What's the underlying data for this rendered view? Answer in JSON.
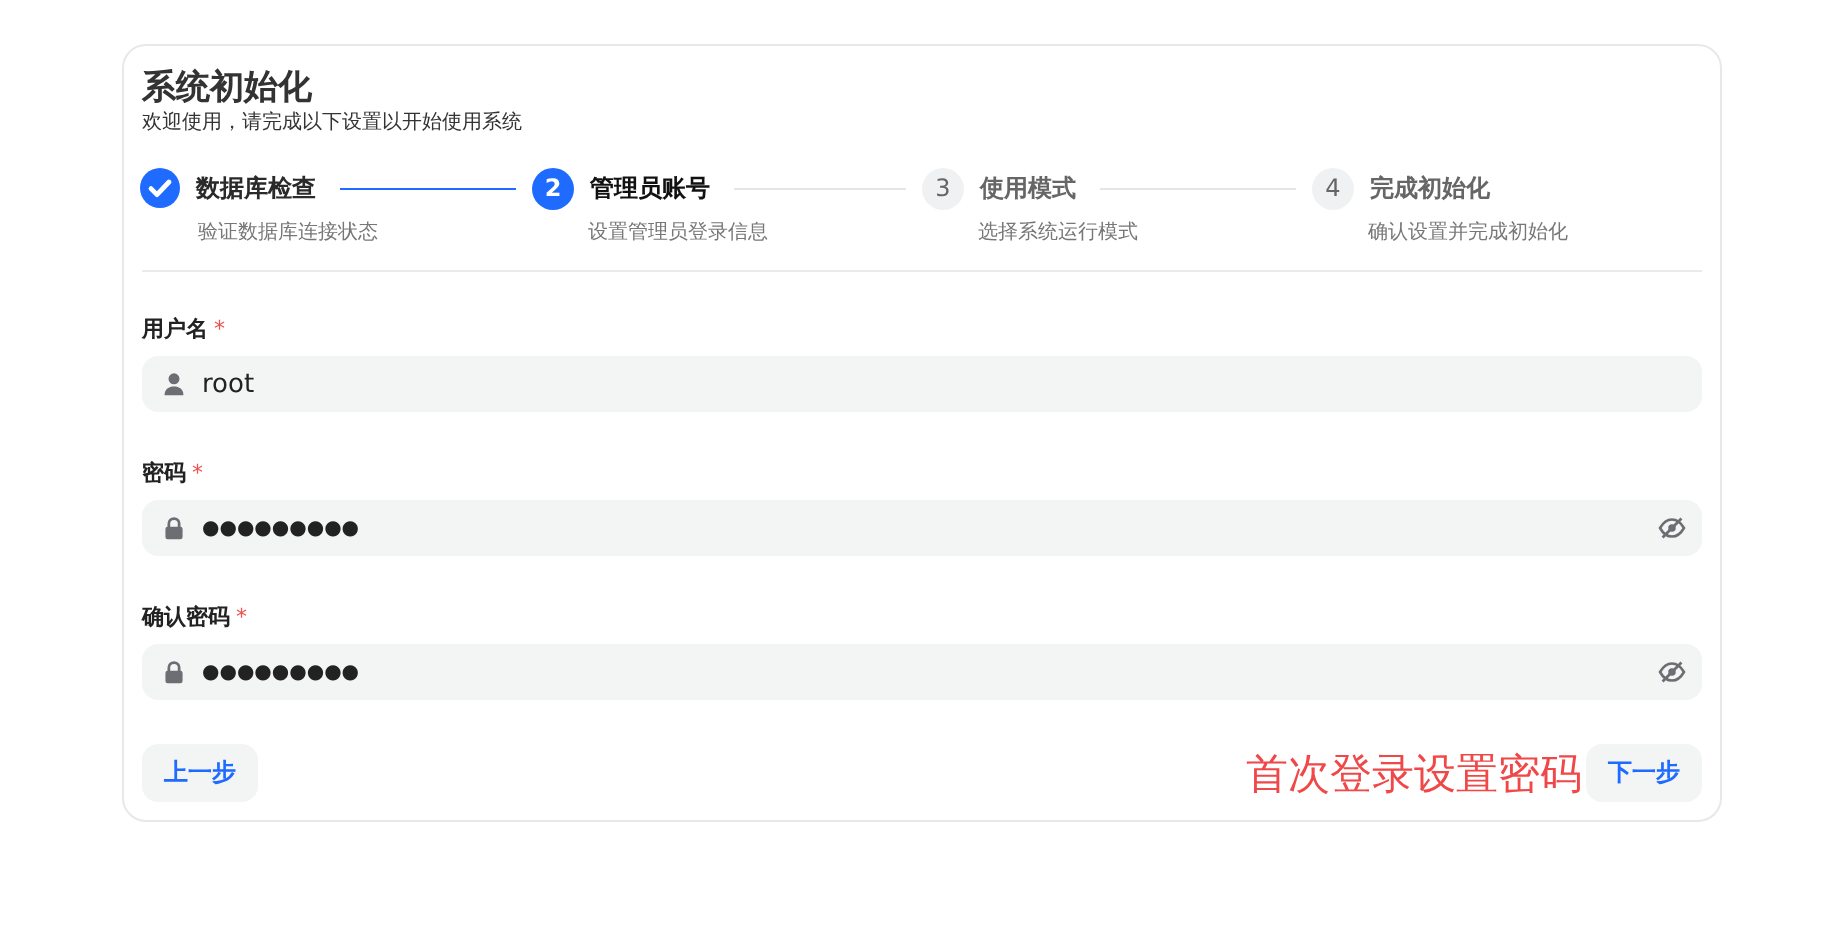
{
  "header": {
    "title": "系统初始化",
    "subtitle": "欢迎使用，请完成以下设置以开始使用系统"
  },
  "steps": [
    {
      "title": "数据库检查",
      "description": "验证数据库连接状态",
      "completed": true,
      "selected": false
    },
    {
      "number": "2",
      "title": "管理员账号",
      "description": "设置管理员登录信息",
      "completed": false,
      "selected": true
    },
    {
      "number": "3",
      "title": "使用模式",
      "description": "选择系统运行模式",
      "completed": false,
      "selected": false
    },
    {
      "number": "4",
      "title": "完成初始化",
      "description": "确认设置并完成初始化",
      "completed": false,
      "selected": false
    }
  ],
  "fields": [
    {
      "label": "用户名",
      "required_mark": "*",
      "kind": "text",
      "value": "root"
    },
    {
      "label": "密码",
      "required_mark": "*",
      "kind": "password",
      "value": "●●●●●●●●●"
    },
    {
      "label": "确认密码",
      "required_mark": "*",
      "kind": "password",
      "value": "●●●●●●●●●"
    }
  ],
  "footer": {
    "back_button": "上一步",
    "annotation": "首次登录设置密码",
    "next_button": "下一步"
  }
}
